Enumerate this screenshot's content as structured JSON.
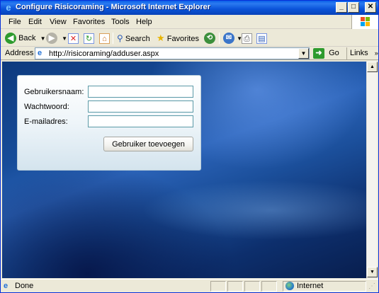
{
  "window": {
    "title": "Configure Risicoraming - Microsoft Internet Explorer",
    "minimize": "_",
    "maximize": "□",
    "close": "✕"
  },
  "menu": [
    "File",
    "Edit",
    "View",
    "Favorites",
    "Tools",
    "Help"
  ],
  "toolbar": {
    "back_label": "Back",
    "search_label": "Search",
    "favorites_label": "Favorites"
  },
  "address": {
    "label": "Address",
    "url": "http://risicoraming/adduser.aspx",
    "go_label": "Go",
    "links_label": "Links"
  },
  "form": {
    "username_label": "Gebruikersnaam:",
    "password_label": "Wachtwoord:",
    "email_label": "E-mailadres:",
    "username_value": "",
    "password_value": "",
    "email_value": "",
    "submit_label": "Gebruiker toevoegen"
  },
  "status": {
    "text": "Done",
    "zone": "Internet"
  },
  "colors": {
    "titlebar": "#0a53d8",
    "chrome": "#ece9d8",
    "input_border": "#5b9aa7"
  }
}
